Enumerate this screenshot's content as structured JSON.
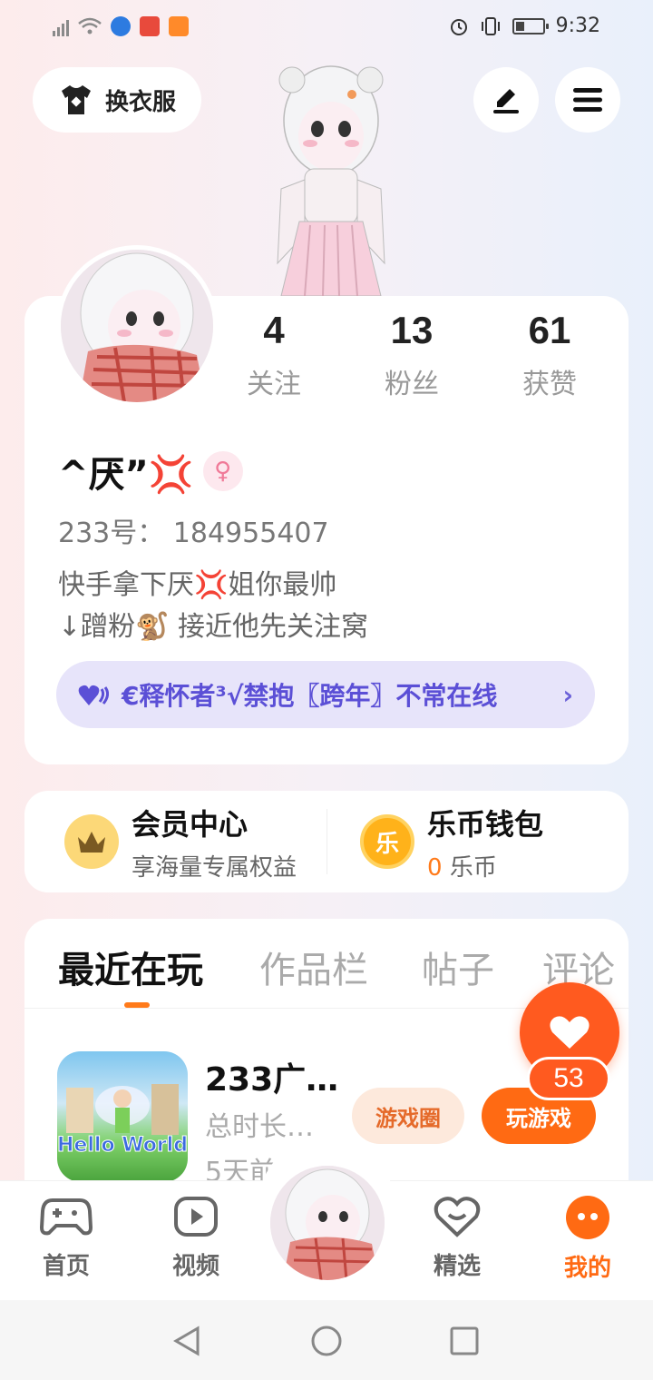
{
  "status_bar": {
    "time": "9:32",
    "icons": [
      "signal-icon",
      "wifi-icon",
      "app-icon-blue",
      "app-icon-red",
      "app-icon-orange",
      "alarm-icon",
      "vibrate-icon",
      "battery-icon"
    ]
  },
  "top": {
    "outfit_label": "换衣服",
    "outfit_icon": "shirt-icon",
    "edit_icon": "pencil-icon",
    "menu_icon": "menu-icon"
  },
  "profile": {
    "stats": [
      {
        "value": "4",
        "label": "关注"
      },
      {
        "value": "13",
        "label": "粉丝"
      },
      {
        "value": "61",
        "label": "获赞"
      }
    ],
    "username": "^厌”💢",
    "gender": "♀",
    "uid": "233号： 184955407",
    "bio_line1": "快手拿下厌💢姐你最帅",
    "bio_line2": "↓蹭粉🐒 接近他先关注窝",
    "badge_text": "€释怀者³√禁抱〖跨年〗不常在线",
    "badge_chevron": "›"
  },
  "member": {
    "title": "会员中心",
    "subtitle": "享海量专属权益"
  },
  "wallet": {
    "title": "乐币钱包",
    "amount": "0",
    "unit": "乐币",
    "coin_char": "乐"
  },
  "tabs": [
    {
      "label": "最近在玩",
      "active": true
    },
    {
      "label": "作品栏",
      "active": false
    },
    {
      "label": "帖子",
      "active": false
    },
    {
      "label": "评论",
      "active": false
    }
  ],
  "game": {
    "title": "233广…",
    "playtime": "总时长…",
    "last_played": "5天前",
    "icon_text": "Hello World",
    "circle_label": "游戏圈",
    "play_label": "玩游戏"
  },
  "like": {
    "count": "53"
  },
  "nav": [
    {
      "label": "首页",
      "icon": "gamepad-icon",
      "active": false
    },
    {
      "label": "视频",
      "icon": "video-icon",
      "active": false
    },
    {
      "label": "精选",
      "icon": "heart-badge-icon",
      "active": false
    },
    {
      "label": "我的",
      "icon": "profile-face-icon",
      "active": true
    }
  ],
  "colors": {
    "accent": "#ff6a13",
    "badge_bg": "#e7e4fa",
    "badge_text": "#5b4fd6"
  }
}
